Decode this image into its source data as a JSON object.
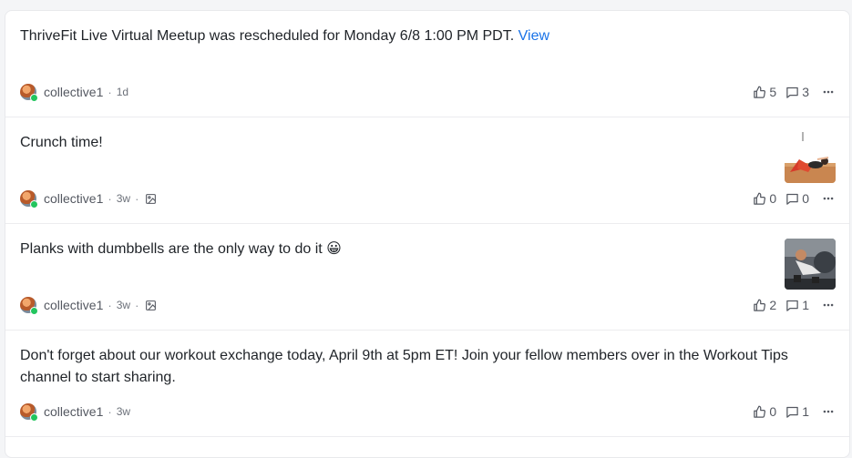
{
  "posts": [
    {
      "text": "ThriveFit Live Virtual Meetup was rescheduled for Monday 6/8 1:00 PM PDT.",
      "link": "View",
      "author": "collective1",
      "time": "1d",
      "likes": "5",
      "comments": "3"
    },
    {
      "text": "Crunch time!",
      "author": "collective1",
      "time": "3w",
      "likes": "0",
      "comments": "0"
    },
    {
      "text": "Planks with dumbbells are the only way to do it 😀",
      "author": "collective1",
      "time": "3w",
      "likes": "2",
      "comments": "1"
    },
    {
      "text": "Don't forget about our workout exchange today, April 9th at 5pm ET! Join your fellow members over in the Workout Tips channel to start sharing.",
      "author": "collective1",
      "time": "3w",
      "likes": "0",
      "comments": "1"
    }
  ],
  "icons": {
    "like": "thumbs-up-icon",
    "comment": "comment-icon",
    "more": "more-horizontal-icon",
    "image": "image-icon"
  },
  "colors": {
    "link": "#1a73e8",
    "online": "#22c55e"
  }
}
